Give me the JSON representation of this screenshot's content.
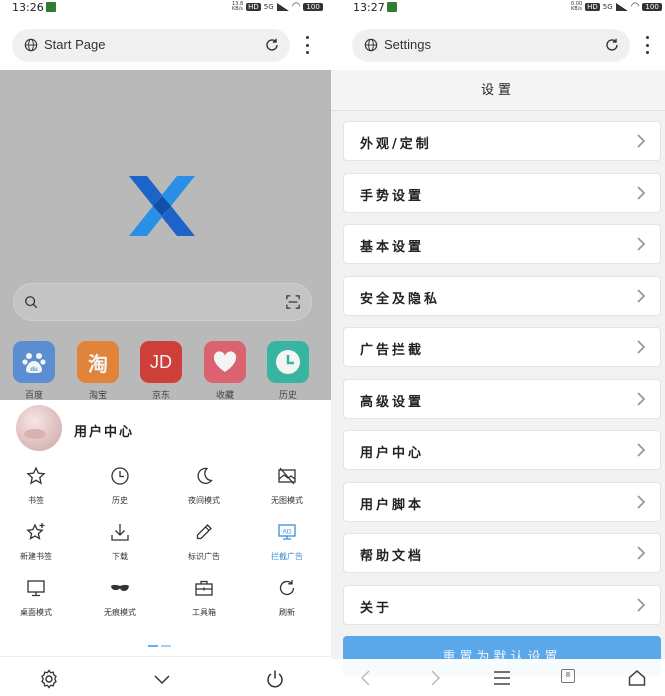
{
  "left": {
    "status": {
      "time": "13:26",
      "speed": "13.8\nKB/s",
      "net": "HD",
      "sig": "5G",
      "battery": "100"
    },
    "address_bar": {
      "text": "Start Page"
    },
    "shortcuts": [
      {
        "label": "百度",
        "icon": "du",
        "color": "#4b86d8"
      },
      {
        "label": "淘宝",
        "icon": "淘",
        "color": "#e87a22"
      },
      {
        "label": "京东",
        "icon": "JD",
        "color": "#d42a24"
      },
      {
        "label": "收藏",
        "icon": "heart-icon",
        "color": "#e05563"
      },
      {
        "label": "历史",
        "icon": "clock-icon",
        "color": "#21b59c"
      }
    ],
    "user_center": "用户中心",
    "menu": [
      {
        "label": "书签",
        "icon": "star-icon"
      },
      {
        "label": "历史",
        "icon": "clock-icon"
      },
      {
        "label": "夜间模式",
        "icon": "moon-icon"
      },
      {
        "label": "无图模式",
        "icon": "no-image-icon"
      },
      {
        "label": "新建书签",
        "icon": "star-plus-icon"
      },
      {
        "label": "下载",
        "icon": "download-icon"
      },
      {
        "label": "标识广告",
        "icon": "pen-icon"
      },
      {
        "label": "拦截广告",
        "icon": "ad-block-icon",
        "active": true
      },
      {
        "label": "桌面模式",
        "icon": "desktop-icon"
      },
      {
        "label": "无痕模式",
        "icon": "mask-icon"
      },
      {
        "label": "工具箱",
        "icon": "toolbox-icon"
      },
      {
        "label": "刷新",
        "icon": "refresh-icon"
      }
    ]
  },
  "right": {
    "status": {
      "time": "13:27",
      "speed": "0.00\nKB/s",
      "net": "HD",
      "sig": "5G",
      "battery": "100"
    },
    "address_bar": {
      "text": "Settings"
    },
    "header": "设置",
    "rows": [
      "外观/定制",
      "手势设置",
      "基本设置",
      "安全及隐私",
      "广告拦截",
      "高级设置",
      "用户中心",
      "用户脚本",
      "帮助文档",
      "关于"
    ],
    "blue_button": "重置为默认设置",
    "tab_count": "8"
  },
  "colors": {
    "accent": "#3a8fd9",
    "button_blue": "#5aa7ea"
  }
}
